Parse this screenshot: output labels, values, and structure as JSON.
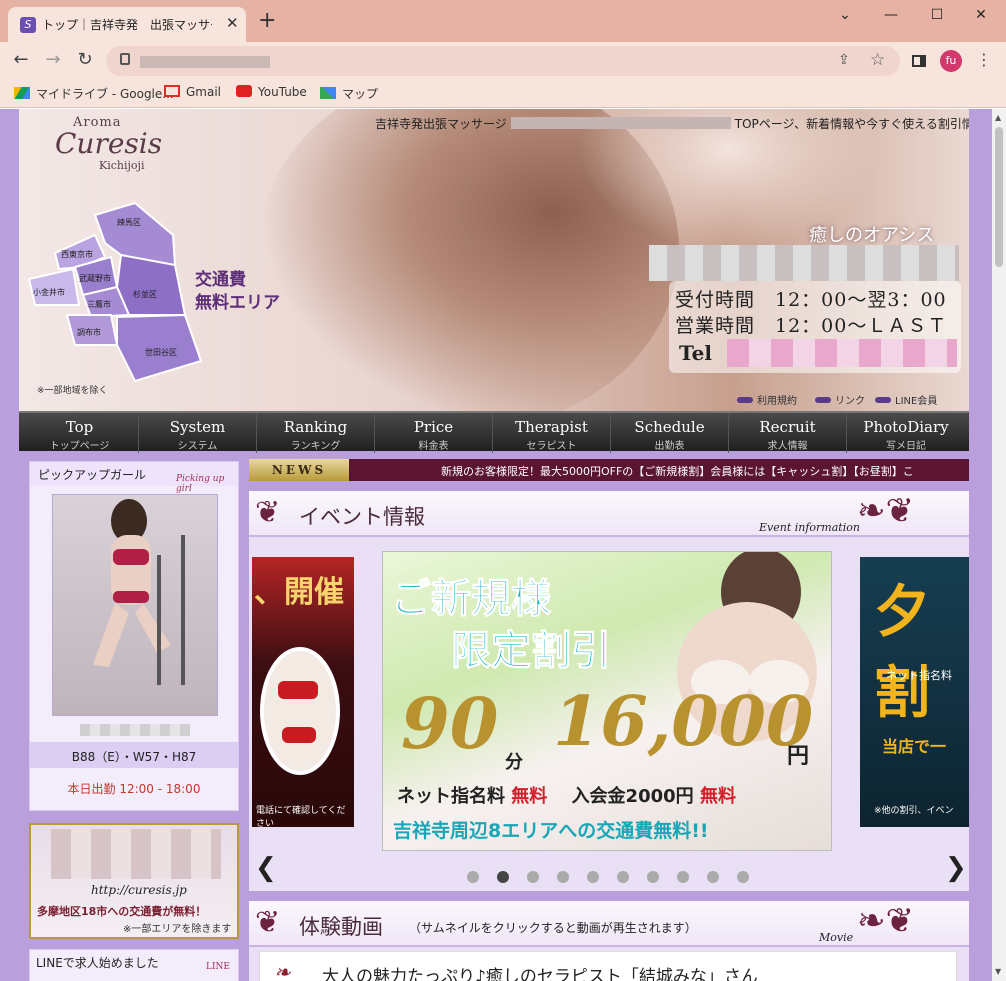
{
  "browser": {
    "tab_title": "トップ｜吉祥寺発　出張マッサージ",
    "bookmarks": [
      "マイドライブ - Google...",
      "Gmail",
      "YouTube",
      "マップ"
    ],
    "profile_initial": "fu",
    "colors": {
      "tabbar": "#e6b2a3",
      "toolbar": "#f7e4dd"
    }
  },
  "header": {
    "logo": {
      "aroma": "Aroma",
      "name": "Curesis",
      "sub": "Kichijoji"
    },
    "tagline_left": "吉祥寺発出張マッサージ",
    "tagline_right": "TOPページ、新着情報や今すぐ使える割引情報",
    "map_areas": [
      "練馬区",
      "西東京市",
      "武蔵野市",
      "小金井市",
      "杉並区",
      "三鷹市",
      "調布市",
      "世田谷区"
    ],
    "map_free_1": "交通費",
    "map_free_2": "無料エリア",
    "map_note": "※一部地域を除く",
    "oasis": "癒しのオアシス",
    "hours_reception": "受付時間　12：00～翌3：00",
    "hours_business": "営業時間　12：00～ＬＡＳＴ",
    "tel_label": "Tel",
    "links": [
      "利用規約",
      "リンク",
      "LINE会員"
    ]
  },
  "nav": [
    {
      "en": "Top",
      "jp": "トップページ"
    },
    {
      "en": "System",
      "jp": "システム"
    },
    {
      "en": "Ranking",
      "jp": "ランキング"
    },
    {
      "en": "Price",
      "jp": "料金表"
    },
    {
      "en": "Therapist",
      "jp": "セラピスト"
    },
    {
      "en": "Schedule",
      "jp": "出勤表"
    },
    {
      "en": "Recruit",
      "jp": "求人情報"
    },
    {
      "en": "PhotoDiary",
      "jp": "写メ日記"
    }
  ],
  "pickup": {
    "title": "ピックアップガール",
    "sub": "Picking up girl",
    "measurements": "B88（E）・W57・H87",
    "work": "本日出勤 12:00 - 18:00"
  },
  "banner2": {
    "url": "http://curesis.jp",
    "line1": "多摩地区18市への交通費が無料！",
    "line2": "※一部エリアを除きます"
  },
  "linebox": {
    "title": "LINEで求人始めました",
    "sub": "LINE"
  },
  "news": {
    "label": "NEWS",
    "text": "新規のお客様限定！最大5000円OFFの【ご新規様割】会員様には【キャッシュ割】【お昼割】こ"
  },
  "event": {
    "title": "イベント情報",
    "sub": "Event information",
    "slide_left_title": "、開催",
    "slide_left_bottom": "電話にて確認してください",
    "main": {
      "headline1": "ご新規様",
      "headline2": "限定割引",
      "minutes": "90",
      "minutes_unit": "分",
      "price": "16,000",
      "price_unit": "円",
      "fee_line_a": "ネット指名料",
      "fee_line_b": "無料",
      "fee_line_c": "入会金2000円",
      "fee_line_d": "無料",
      "area_line": "吉祥寺周辺8エリアへの交通費無料!!"
    },
    "slide_right_title": "夕割",
    "slide_right_sub": "ネット指名料",
    "slide_right_mid": "当店で一",
    "slide_right_bottom": "※他の割引、イベン",
    "prev": "❮",
    "next": "❯",
    "dots_total": 10,
    "dots_active": 2
  },
  "video": {
    "title": "体験動画",
    "note": "（サムネイルをクリックすると動画が再生されます）",
    "sub": "Movie",
    "item": "大人の魅力たっぷり♪癒しのセラピスト「結城みな」さん"
  }
}
